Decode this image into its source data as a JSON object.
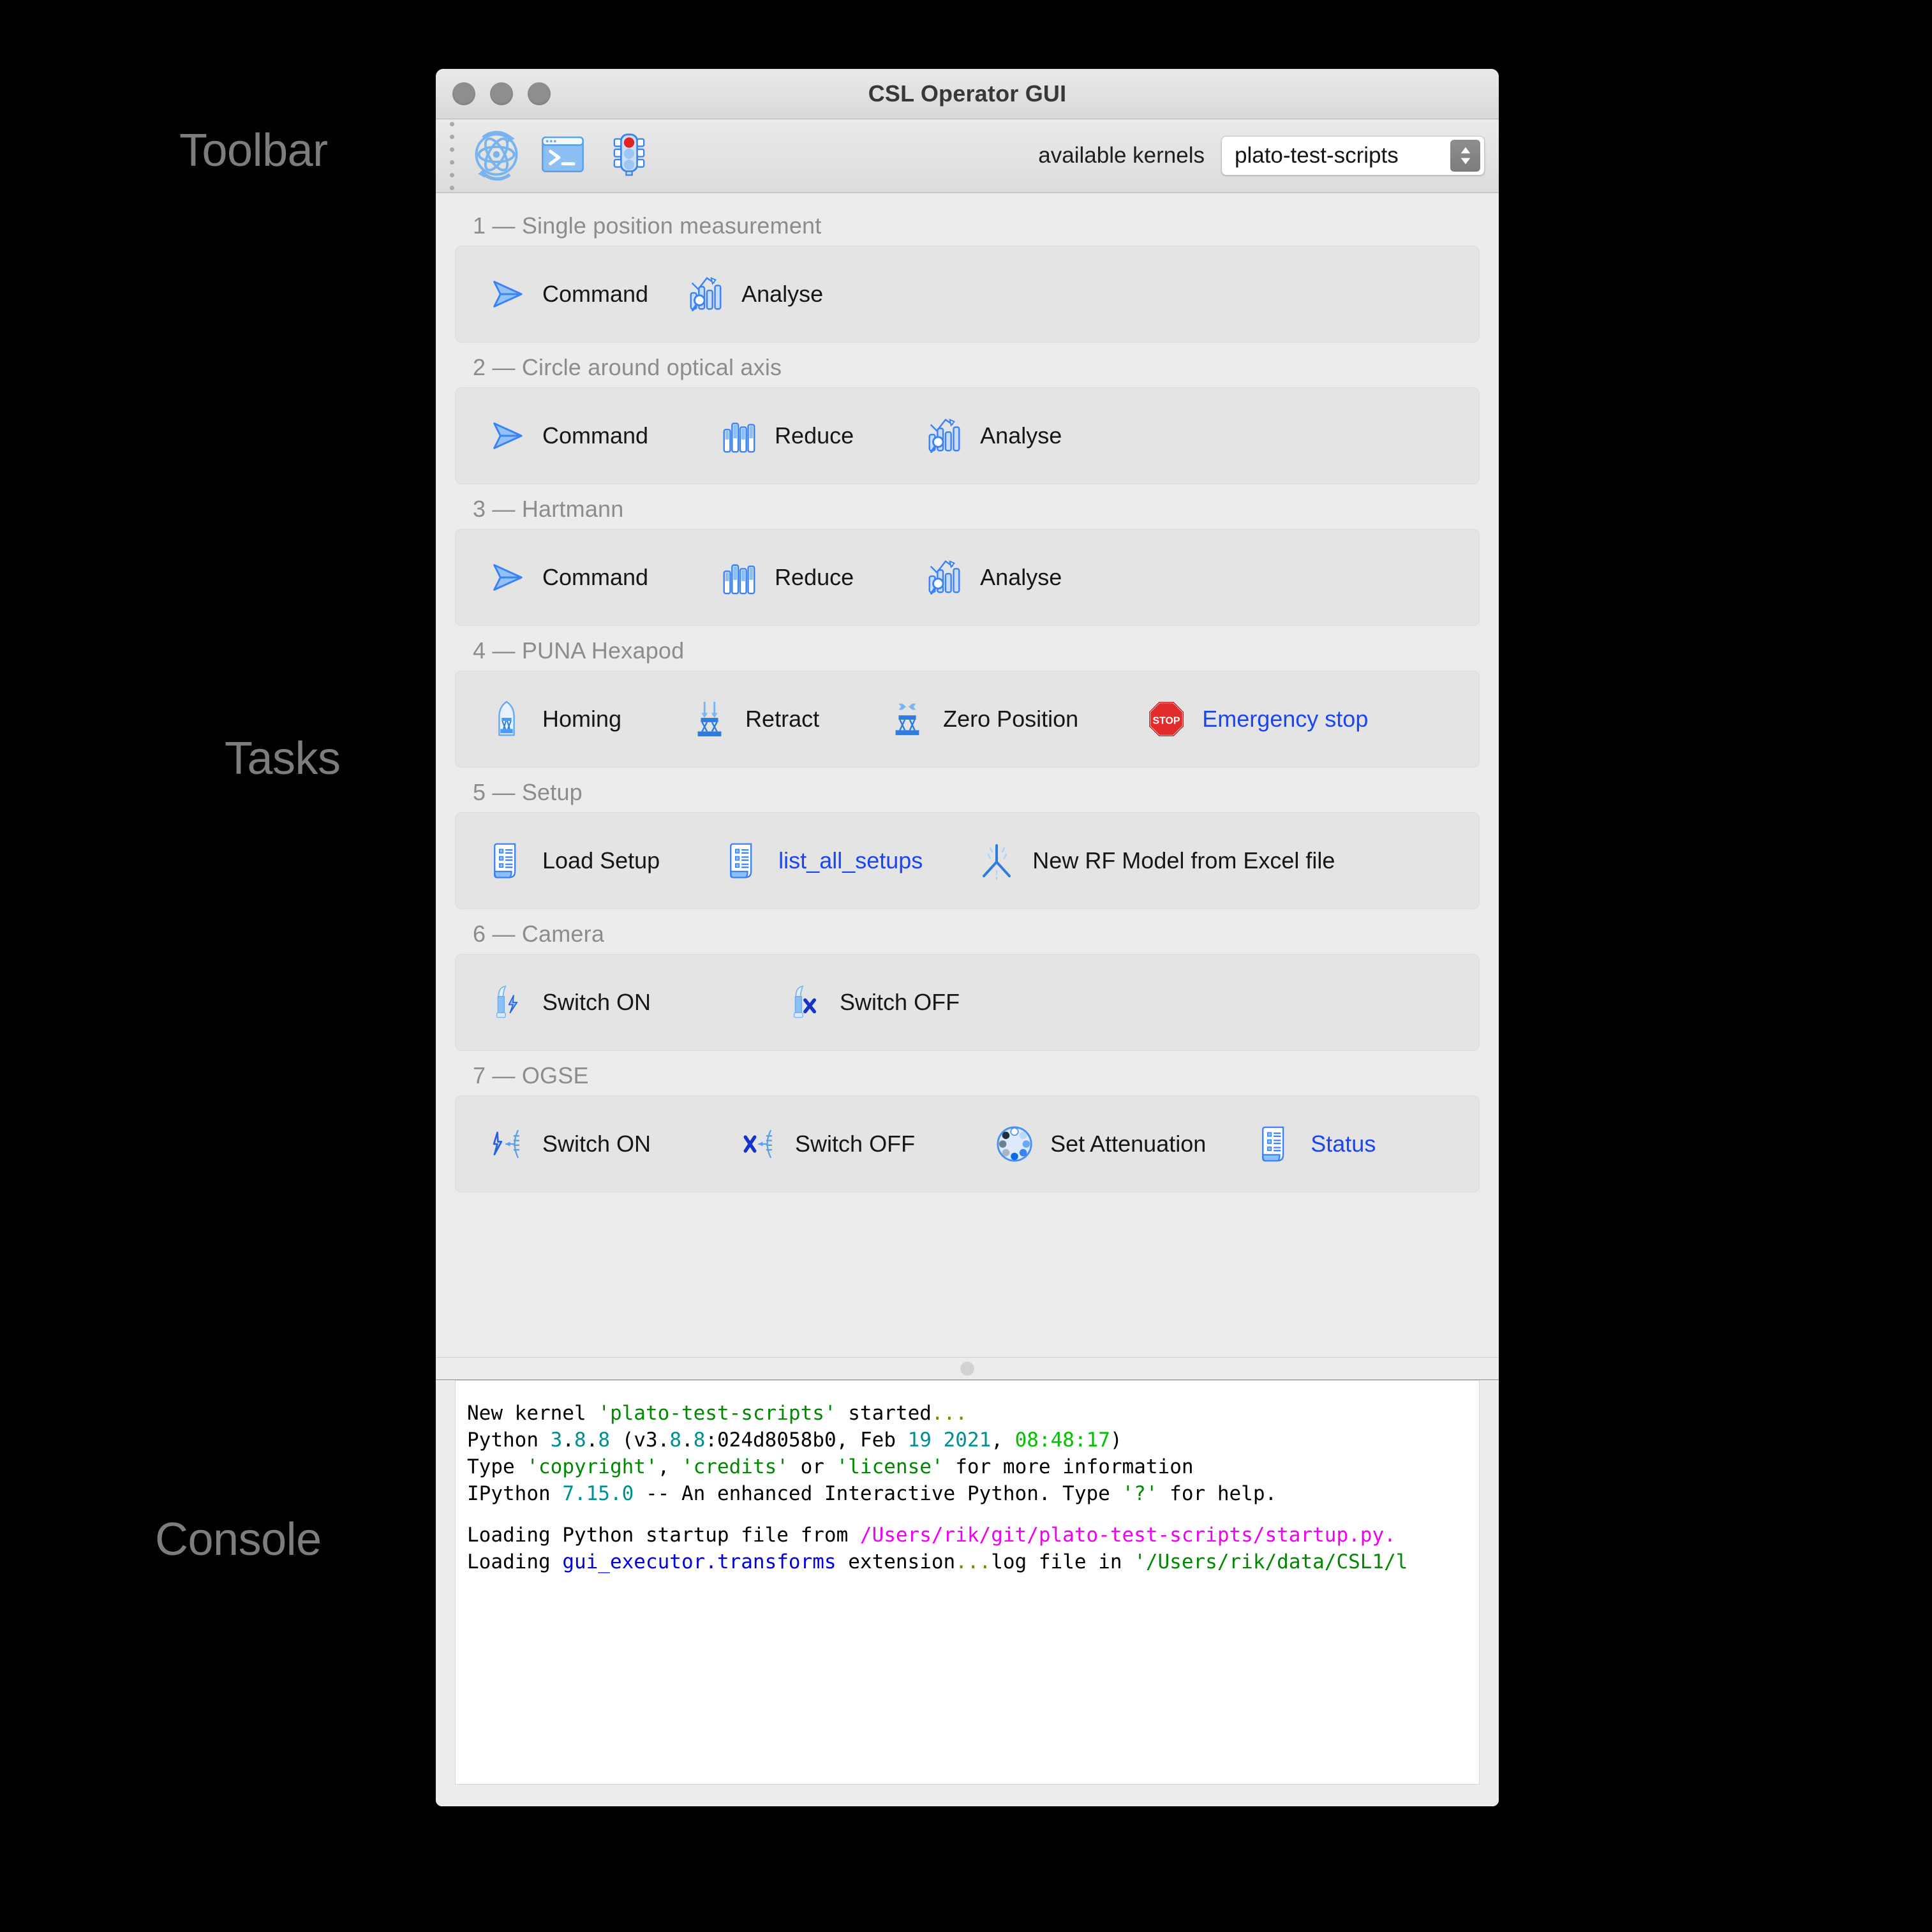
{
  "annotations": {
    "toolbar": "Toolbar",
    "tasks": "Tasks",
    "console": "Console"
  },
  "window": {
    "title": "CSL Operator GUI",
    "traffic_lights": [
      "close-button",
      "minimize-button",
      "zoom-button"
    ]
  },
  "toolbar": {
    "buttons": [
      {
        "name": "restart-kernel-button",
        "icon": "atom-restart-icon"
      },
      {
        "name": "open-console-button",
        "icon": "terminal-icon"
      },
      {
        "name": "kernel-status-button",
        "icon": "traffic-light-icon"
      }
    ],
    "kernels_label": "available kernels",
    "kernel_select": {
      "value": "plato-test-scripts",
      "icon": "updown-chevron-icon"
    }
  },
  "tasks": {
    "sections": [
      {
        "title": "1 — Single position measurement",
        "buttons": [
          {
            "label": "Command",
            "icon": "paper-plane-icon",
            "link": false
          },
          {
            "label": "Analyse",
            "icon": "analyse-chart-icon",
            "link": false
          }
        ]
      },
      {
        "title": "2 — Circle around optical axis",
        "buttons": [
          {
            "label": "Command",
            "icon": "paper-plane-icon",
            "link": false
          },
          {
            "label": "Reduce",
            "icon": "bar-chart-icon",
            "link": false
          },
          {
            "label": "Analyse",
            "icon": "analyse-chart-icon",
            "link": false
          }
        ]
      },
      {
        "title": "3 — Hartmann",
        "buttons": [
          {
            "label": "Command",
            "icon": "paper-plane-icon",
            "link": false
          },
          {
            "label": "Reduce",
            "icon": "bar-chart-icon",
            "link": false
          },
          {
            "label": "Analyse",
            "icon": "analyse-chart-icon",
            "link": false
          }
        ]
      },
      {
        "title": "4 — PUNA Hexapod",
        "buttons": [
          {
            "label": "Homing",
            "icon": "hexapod-homing-icon",
            "link": false
          },
          {
            "label": "Retract",
            "icon": "hexapod-retract-icon",
            "link": false
          },
          {
            "label": "Zero Position",
            "icon": "hexapod-zero-icon",
            "link": false
          },
          {
            "label": "Emergency stop",
            "icon": "stop-sign-icon",
            "link": true
          }
        ]
      },
      {
        "title": "5 — Setup",
        "buttons": [
          {
            "label": "Load Setup",
            "icon": "setup-list-icon",
            "link": false
          },
          {
            "label": "list_all_setups",
            "icon": "setup-list-icon",
            "link": true
          },
          {
            "label": "New RF Model from Excel file",
            "icon": "reference-frame-icon",
            "link": false
          }
        ]
      },
      {
        "title": "6 — Camera",
        "buttons": [
          {
            "label": "Switch ON",
            "icon": "camera-on-icon",
            "link": false
          },
          {
            "label": "Switch OFF",
            "icon": "camera-off-icon",
            "link": false
          }
        ]
      },
      {
        "title": "7 — OGSE",
        "buttons": [
          {
            "label": "Switch ON",
            "icon": "ogse-on-icon",
            "link": false
          },
          {
            "label": "Switch OFF",
            "icon": "ogse-off-icon",
            "link": false
          },
          {
            "label": "Set Attenuation",
            "icon": "filter-wheel-icon",
            "link": false
          },
          {
            "label": "Status",
            "icon": "setup-list-icon",
            "link": true
          }
        ]
      }
    ]
  },
  "console": {
    "lines": [
      "New kernel 'plato-test-scripts' started...",
      "Python 3.8.8 (v3.8.8:024d8058b0, Feb 19 2021, 08:48:17)",
      "Type 'copyright', 'credits' or 'license' for more information",
      "IPython 7.15.0 -- An enhanced Interactive Python. Type '?' for help.",
      "",
      "Loading Python startup file from /Users/rik/git/plato-test-scripts/startup.py.",
      "Loading gui_executor.transforms extension...log file in '/Users/rik/data/CSL1/l"
    ]
  },
  "colors": {
    "accent_blue": "#4a90f0",
    "link_blue": "#1b45f0",
    "stop_red": "#e02020",
    "panel_gray": "#e4e4e4",
    "window_gray": "#ececec"
  }
}
